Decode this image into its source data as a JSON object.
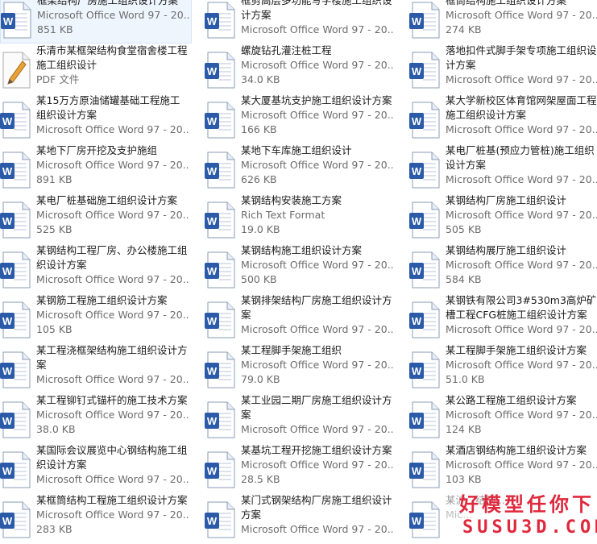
{
  "colors": {
    "word_blue": "#2b5ba8",
    "pdf_orange": "#e8a23a",
    "watermark_red": "#e0283c",
    "selection": "#eef5fd"
  },
  "files": [
    [
      {
        "name": "框架结构厂房施工组织设计方案",
        "type": "Microsoft Office Word 97 - 20...",
        "size": "851 KB",
        "icon": "word-doc-icon",
        "selected": true
      },
      {
        "name": "框剪高层多功能写字楼施工组织设计方案",
        "type": "Microsoft Office Word 97 - 20...",
        "size": "",
        "icon": "word-doc-icon"
      },
      {
        "name": "框筒结构施工组织设计方案",
        "type": "Microsoft Office Word 97 - 20...",
        "size": "274 KB",
        "icon": "word-doc-icon"
      }
    ],
    [
      {
        "name": "乐清市某框架结构食堂宿舍楼工程施工组织设计",
        "type": "PDF 文件",
        "size": "",
        "icon": "pdf-doc-icon"
      },
      {
        "name": "螺旋钻孔灌注桩工程",
        "type": "Microsoft Office Word 97 - 20...",
        "size": "34.0 KB",
        "icon": "word-doc-icon"
      },
      {
        "name": "落地扣件式脚手架专项施工组织设计方案",
        "type": "Microsoft Office Word 97 - 20...",
        "size": "",
        "icon": "word-doc-icon"
      }
    ],
    [
      {
        "name": "某15万方原油储罐基础工程施工组织设计方案",
        "type": "Microsoft Office Word 97 - 20...",
        "size": "",
        "icon": "word-doc-icon"
      },
      {
        "name": "某大厦基坑支护施工组织设计方案",
        "type": "Microsoft Office Word 97 - 20...",
        "size": "166 KB",
        "icon": "word-doc-icon"
      },
      {
        "name": "某大学新校区体育馆网架屋面工程施工组织设计方案",
        "type": "Microsoft Office Word 97 - 20...",
        "size": "",
        "icon": "word-doc-icon"
      }
    ],
    [
      {
        "name": "某地下厂房开挖及支护施组",
        "type": "Microsoft Office Word 97 - 20...",
        "size": "891 KB",
        "icon": "word-doc-icon"
      },
      {
        "name": "某地下车库施工组织设计",
        "type": "Microsoft Office Word 97 - 20...",
        "size": "626 KB",
        "icon": "word-doc-icon"
      },
      {
        "name": "某电厂桩基(预应力管桩)施工组织设计方案",
        "type": "Microsoft Office Word 97 - 20...",
        "size": "",
        "icon": "word-doc-icon"
      }
    ],
    [
      {
        "name": "某电厂桩基础施工组织设计方案",
        "type": "Microsoft Office Word 97 - 20...",
        "size": "525 KB",
        "icon": "word-doc-icon"
      },
      {
        "name": "某钢结构安装施工方案",
        "type": "Rich Text Format",
        "size": "19.0 KB",
        "icon": "rtf-doc-icon"
      },
      {
        "name": "某钢结构厂房施工组织设计",
        "type": "Microsoft Office Word 97 - 20...",
        "size": "505 KB",
        "icon": "word-doc-icon"
      }
    ],
    [
      {
        "name": "某钢结构工程厂房、办公楼施工组织设计方案",
        "type": "Microsoft Office Word 97 - 20...",
        "size": "",
        "icon": "word-doc-icon"
      },
      {
        "name": "某钢结构施工组织设计方案",
        "type": "Microsoft Office Word 97 - 20...",
        "size": "500 KB",
        "icon": "word-doc-icon"
      },
      {
        "name": "某钢结构展厅施工组织设计",
        "type": "Microsoft Office Word 97 - 20...",
        "size": "584 KB",
        "icon": "word-doc-icon"
      }
    ],
    [
      {
        "name": "某钢筋工程施工组织设计方案",
        "type": "Microsoft Office Word 97 - 20...",
        "size": "105 KB",
        "icon": "word-doc-icon"
      },
      {
        "name": "某钢排架结构厂房施工组织设计方案",
        "type": "Microsoft Office Word 97 - 20...",
        "size": "",
        "icon": "word-doc-icon"
      },
      {
        "name": "某钢铁有限公司3#530m3高炉矿槽工程CFG桩施工组织设计方案",
        "type": "Microsoft Office Word 97 - 20...",
        "size": "",
        "icon": "word-doc-icon"
      }
    ],
    [
      {
        "name": "某工程浇框架结构施工组织设计方案",
        "type": "Microsoft Office Word 97 - 20...",
        "size": "",
        "icon": "word-doc-icon"
      },
      {
        "name": "某工程脚手架施工组织",
        "type": "Microsoft Office Word 97 - 20...",
        "size": "79.0 KB",
        "icon": "word-doc-icon"
      },
      {
        "name": "某工程脚手架施工组织设计方案",
        "type": "Microsoft Office Word 97 - 20...",
        "size": "51.0 KB",
        "icon": "word-doc-icon"
      }
    ],
    [
      {
        "name": "某工程铆钉式锚杆的施工技术方案",
        "type": "Microsoft Office Word 97 - 20...",
        "size": "38.0 KB",
        "icon": "word-doc-icon"
      },
      {
        "name": "某工业园二期厂房施工组织设计方案",
        "type": "Microsoft Office Word 97 - 20...",
        "size": "",
        "icon": "word-doc-icon"
      },
      {
        "name": "某公路工程施工组织设计方案",
        "type": "Microsoft Office Word 97 - 20...",
        "size": "124 KB",
        "icon": "word-doc-icon"
      }
    ],
    [
      {
        "name": "某国际会议展览中心钢结构施工组织设计方案",
        "type": "Microsoft Office Word 97 - 20...",
        "size": "",
        "icon": "word-doc-icon"
      },
      {
        "name": "某基坑工程开挖施工组织设计方案",
        "type": "Microsoft Office Word 97 - 20...",
        "size": "28.5 KB",
        "icon": "word-doc-icon"
      },
      {
        "name": "某酒店钢结构施工组织设计方案",
        "type": "Microsoft Office Word 97 - 20...",
        "size": "103 KB",
        "icon": "word-doc-icon"
      }
    ],
    [
      {
        "name": "某框筒结构工程施工组织设计方案",
        "type": "Microsoft Office Word 97 - 20...",
        "size": "283 KB",
        "icon": "word-doc-icon"
      },
      {
        "name": "某门式钢架结构厂房施工组织设计方案",
        "type": "Microsoft Office Word 97 - 20...",
        "size": "",
        "icon": "word-doc-icon"
      },
      {
        "name": "某沪...结构...",
        "type": "Mic...",
        "size": "",
        "icon": "word-doc-icon"
      }
    ]
  ],
  "watermark": {
    "line1": "好模型任你下",
    "line2": "SUSU3D.COM"
  }
}
